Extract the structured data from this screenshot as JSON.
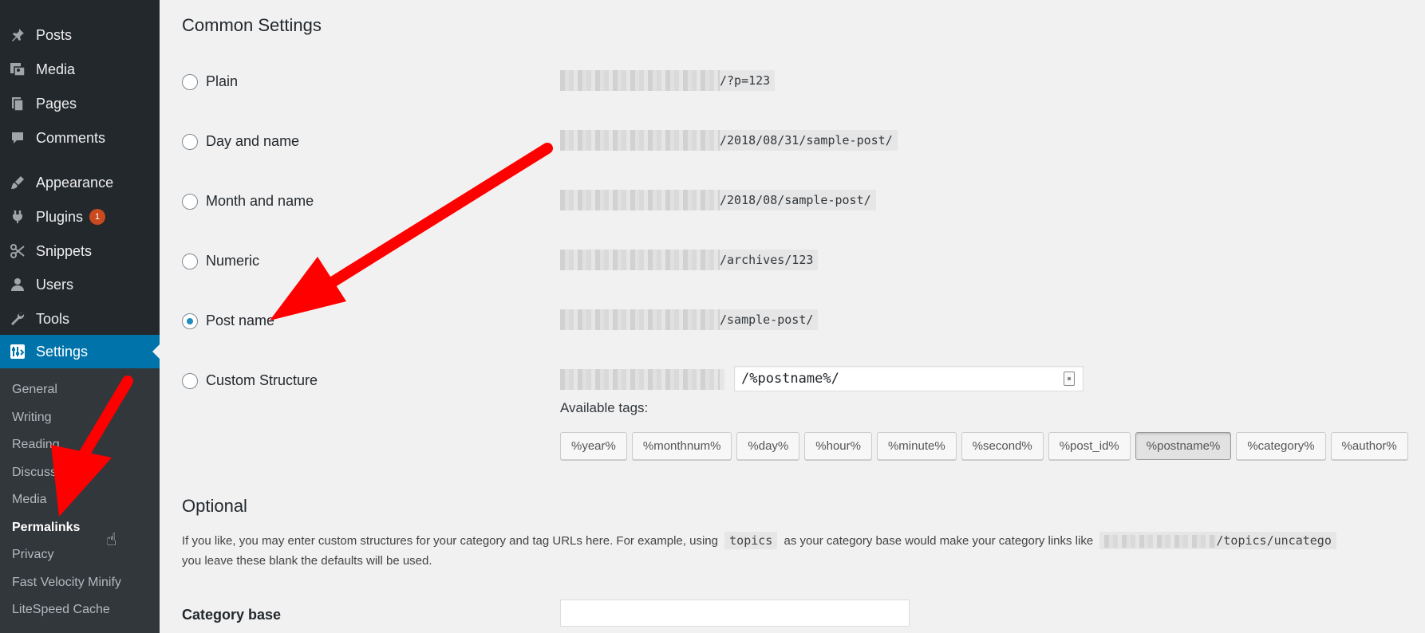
{
  "sidebar": {
    "items": [
      {
        "label": "Posts",
        "icon": "pin-icon"
      },
      {
        "label": "Media",
        "icon": "media-icon"
      },
      {
        "label": "Pages",
        "icon": "pages-icon"
      },
      {
        "label": "Comments",
        "icon": "comments-icon"
      },
      {
        "label": "Appearance",
        "icon": "brush-icon"
      },
      {
        "label": "Plugins",
        "icon": "plugin-icon",
        "badge": "1"
      },
      {
        "label": "Snippets",
        "icon": "scissors-icon"
      },
      {
        "label": "Users",
        "icon": "user-icon"
      },
      {
        "label": "Tools",
        "icon": "wrench-icon"
      },
      {
        "label": "Settings",
        "icon": "settings-icon",
        "active": true
      }
    ],
    "submenu": [
      "General",
      "Writing",
      "Reading",
      "Discussion",
      "Media",
      "Permalinks",
      "Privacy",
      "Fast Velocity Minify",
      "LiteSpeed Cache"
    ],
    "current_submenu": "Permalinks"
  },
  "main": {
    "common_title": "Common Settings",
    "options": [
      {
        "label": "Plain",
        "example": "/?p=123",
        "selected": false
      },
      {
        "label": "Day and name",
        "example": "/2018/08/31/sample-post/",
        "selected": false
      },
      {
        "label": "Month and name",
        "example": "/2018/08/sample-post/",
        "selected": false
      },
      {
        "label": "Numeric",
        "example": "/archives/123",
        "selected": false
      },
      {
        "label": "Post name",
        "example": "/sample-post/",
        "selected": true
      },
      {
        "label": "Custom Structure",
        "selected": false
      }
    ],
    "custom_structure_value": "/%postname%/",
    "available_tags_label": "Available tags:",
    "tags": [
      "%year%",
      "%monthnum%",
      "%day%",
      "%hour%",
      "%minute%",
      "%second%",
      "%post_id%",
      "%postname%",
      "%category%",
      "%author%"
    ],
    "active_tag": "%postname%",
    "optional_title": "Optional",
    "optional_text_1": "If you like, you may enter custom structures for your category and tag URLs here. For example, using",
    "optional_code": "topics",
    "optional_text_2": "as your category base would make your category links like",
    "optional_example": "/topics/uncatego",
    "optional_text_3": "you leave these blank the defaults will be used.",
    "category_base_label": "Category base",
    "category_base_value": ""
  },
  "colors": {
    "sidebar_bg": "#23282d",
    "submenu_bg": "#32373c",
    "active": "#0073aa",
    "arrow": "#ff0000",
    "badge": "#ca4a1f"
  }
}
